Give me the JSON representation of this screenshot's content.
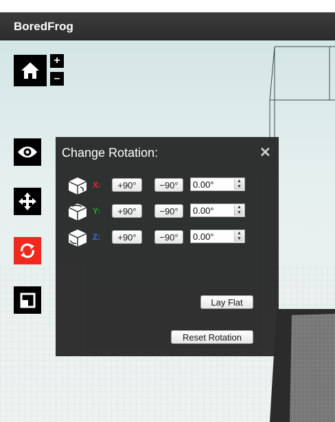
{
  "app": {
    "title": "BoredFrog"
  },
  "toolbar": {
    "items": [
      {
        "name": "home-icon"
      },
      {
        "name": "eye-icon"
      },
      {
        "name": "move-icon"
      },
      {
        "name": "rotate-icon",
        "active": true
      },
      {
        "name": "scale-icon"
      }
    ],
    "zoom_in": "+",
    "zoom_out": "–"
  },
  "panel": {
    "title": "Change Rotation:",
    "close": "✕",
    "rows": [
      {
        "axis": "X:",
        "axis_color": "#e0282c",
        "plus": "+90°",
        "minus": "−90°",
        "value": "0.00°"
      },
      {
        "axis": "Y:",
        "axis_color": "#21a52b",
        "plus": "+90°",
        "minus": "−90°",
        "value": "0.00°"
      },
      {
        "axis": "Z:",
        "axis_color": "#2f6fe6",
        "plus": "+90°",
        "minus": "−90°",
        "value": "0.00°"
      }
    ],
    "lay_flat": "Lay Flat",
    "reset": "Reset Rotation"
  },
  "colors": {
    "active_tool": "#f0281e",
    "panel_bg": "#2a2a2a",
    "titlebar": "#333333"
  }
}
